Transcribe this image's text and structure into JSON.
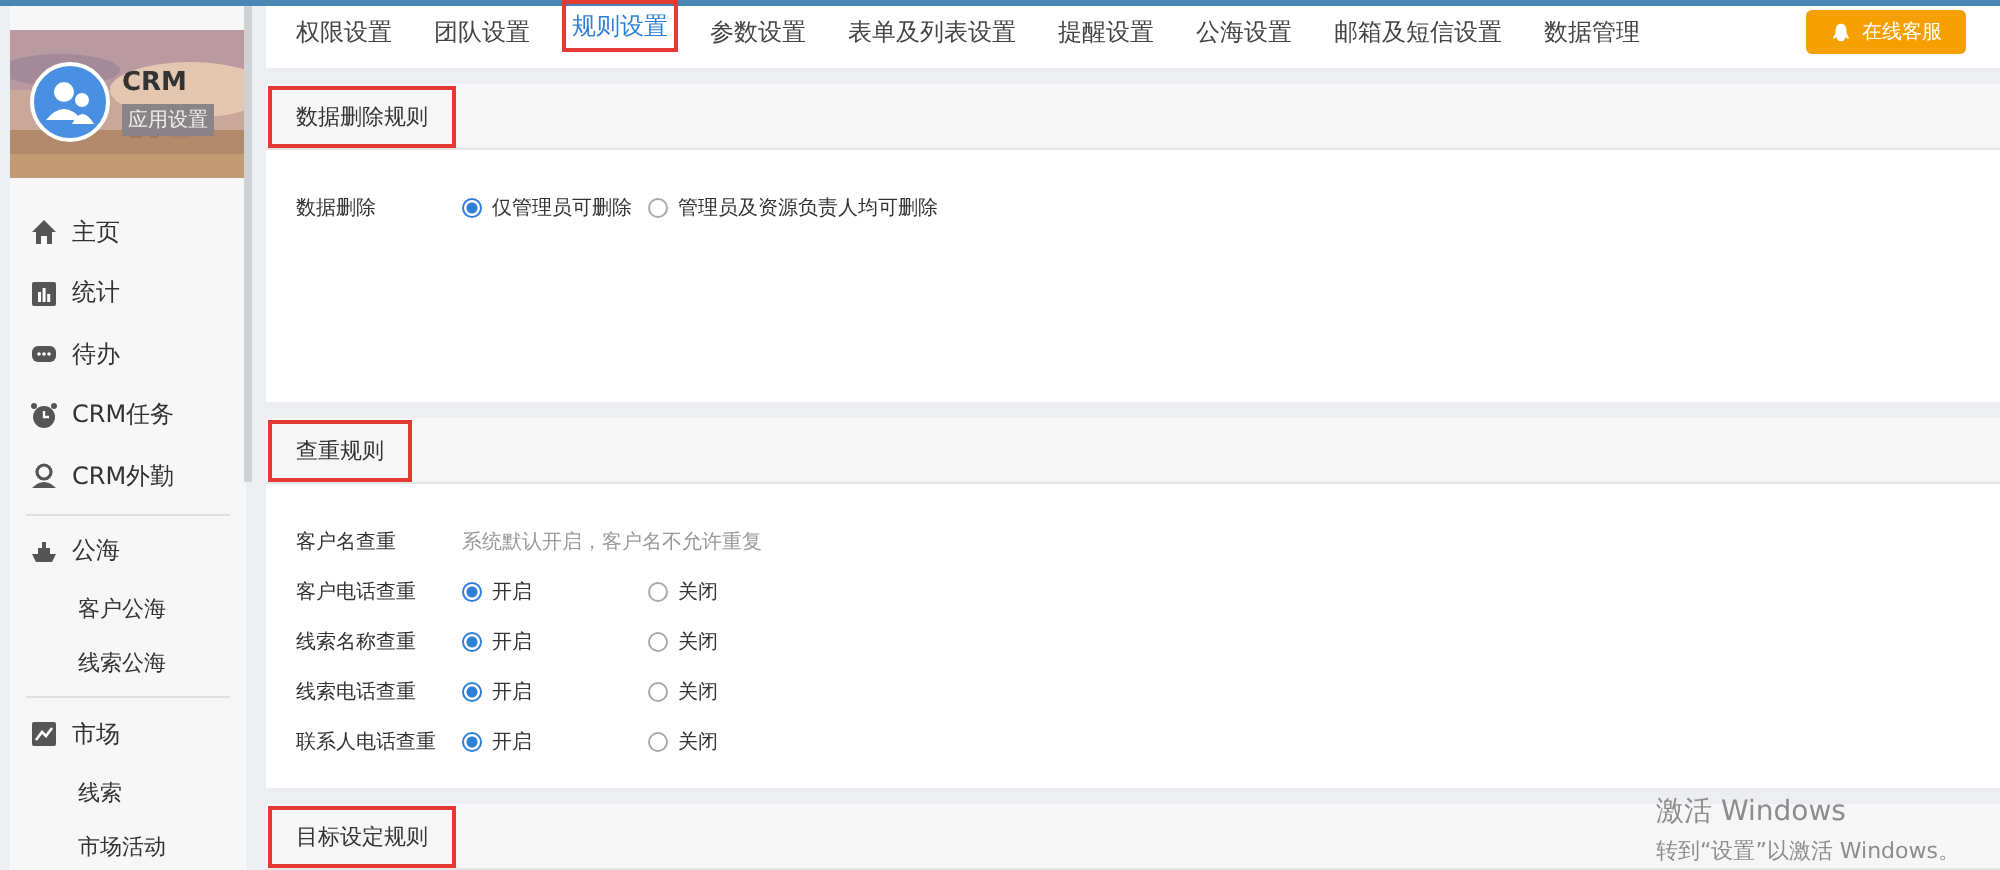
{
  "sidebar": {
    "app_name": "CRM",
    "app_badge": "应用设置",
    "groups": [
      [
        {
          "label": "主页"
        },
        {
          "label": "统计"
        },
        {
          "label": "待办"
        },
        {
          "label": "CRM任务"
        },
        {
          "label": "CRM外勤"
        }
      ],
      [
        {
          "label": "公海",
          "children": [
            {
              "label": "客户公海"
            },
            {
              "label": "线索公海"
            }
          ]
        }
      ],
      [
        {
          "label": "市场",
          "children": [
            {
              "label": "线索"
            },
            {
              "label": "市场活动"
            }
          ]
        }
      ]
    ]
  },
  "tabs": [
    {
      "label": "权限设置",
      "selected": false,
      "highlighted": false
    },
    {
      "label": "团队设置",
      "selected": false,
      "highlighted": false
    },
    {
      "label": "规则设置",
      "selected": true,
      "highlighted": true
    },
    {
      "label": "参数设置",
      "selected": false,
      "highlighted": false
    },
    {
      "label": "表单及列表设置",
      "selected": false,
      "highlighted": false
    },
    {
      "label": "提醒设置",
      "selected": false,
      "highlighted": false
    },
    {
      "label": "公海设置",
      "selected": false,
      "highlighted": false
    },
    {
      "label": "邮箱及短信设置",
      "selected": false,
      "highlighted": false
    },
    {
      "label": "数据管理",
      "selected": false,
      "highlighted": false
    }
  ],
  "service_button": "在线客服",
  "sections": [
    {
      "title": "数据删除规则",
      "highlighted": true,
      "rows": [
        {
          "kind": "radio",
          "label": "数据删除",
          "options": [
            {
              "label": "仅管理员可删除",
              "selected": true
            },
            {
              "label": "管理员及资源负责人均可删除",
              "selected": false
            }
          ]
        }
      ]
    },
    {
      "title": "查重规则",
      "highlighted": true,
      "rows": [
        {
          "kind": "note",
          "label": "客户名查重",
          "note": "系统默认开启，客户名不允许重复"
        },
        {
          "kind": "radio",
          "label": "客户电话查重",
          "options": [
            {
              "label": "开启",
              "selected": true
            },
            {
              "label": "关闭",
              "selected": false
            }
          ]
        },
        {
          "kind": "radio",
          "label": "线索名称查重",
          "options": [
            {
              "label": "开启",
              "selected": true
            },
            {
              "label": "关闭",
              "selected": false
            }
          ]
        },
        {
          "kind": "radio",
          "label": "线索电话查重",
          "options": [
            {
              "label": "开启",
              "selected": true
            },
            {
              "label": "关闭",
              "selected": false
            }
          ]
        },
        {
          "kind": "radio",
          "label": "联系人电话查重",
          "options": [
            {
              "label": "开启",
              "selected": true
            },
            {
              "label": "关闭",
              "selected": false
            }
          ]
        }
      ]
    },
    {
      "title": "目标设定规则",
      "highlighted": true
    }
  ],
  "activation_notice": {
    "title": "激活 Windows",
    "message": "转到“设置”以激活 Windows。"
  }
}
